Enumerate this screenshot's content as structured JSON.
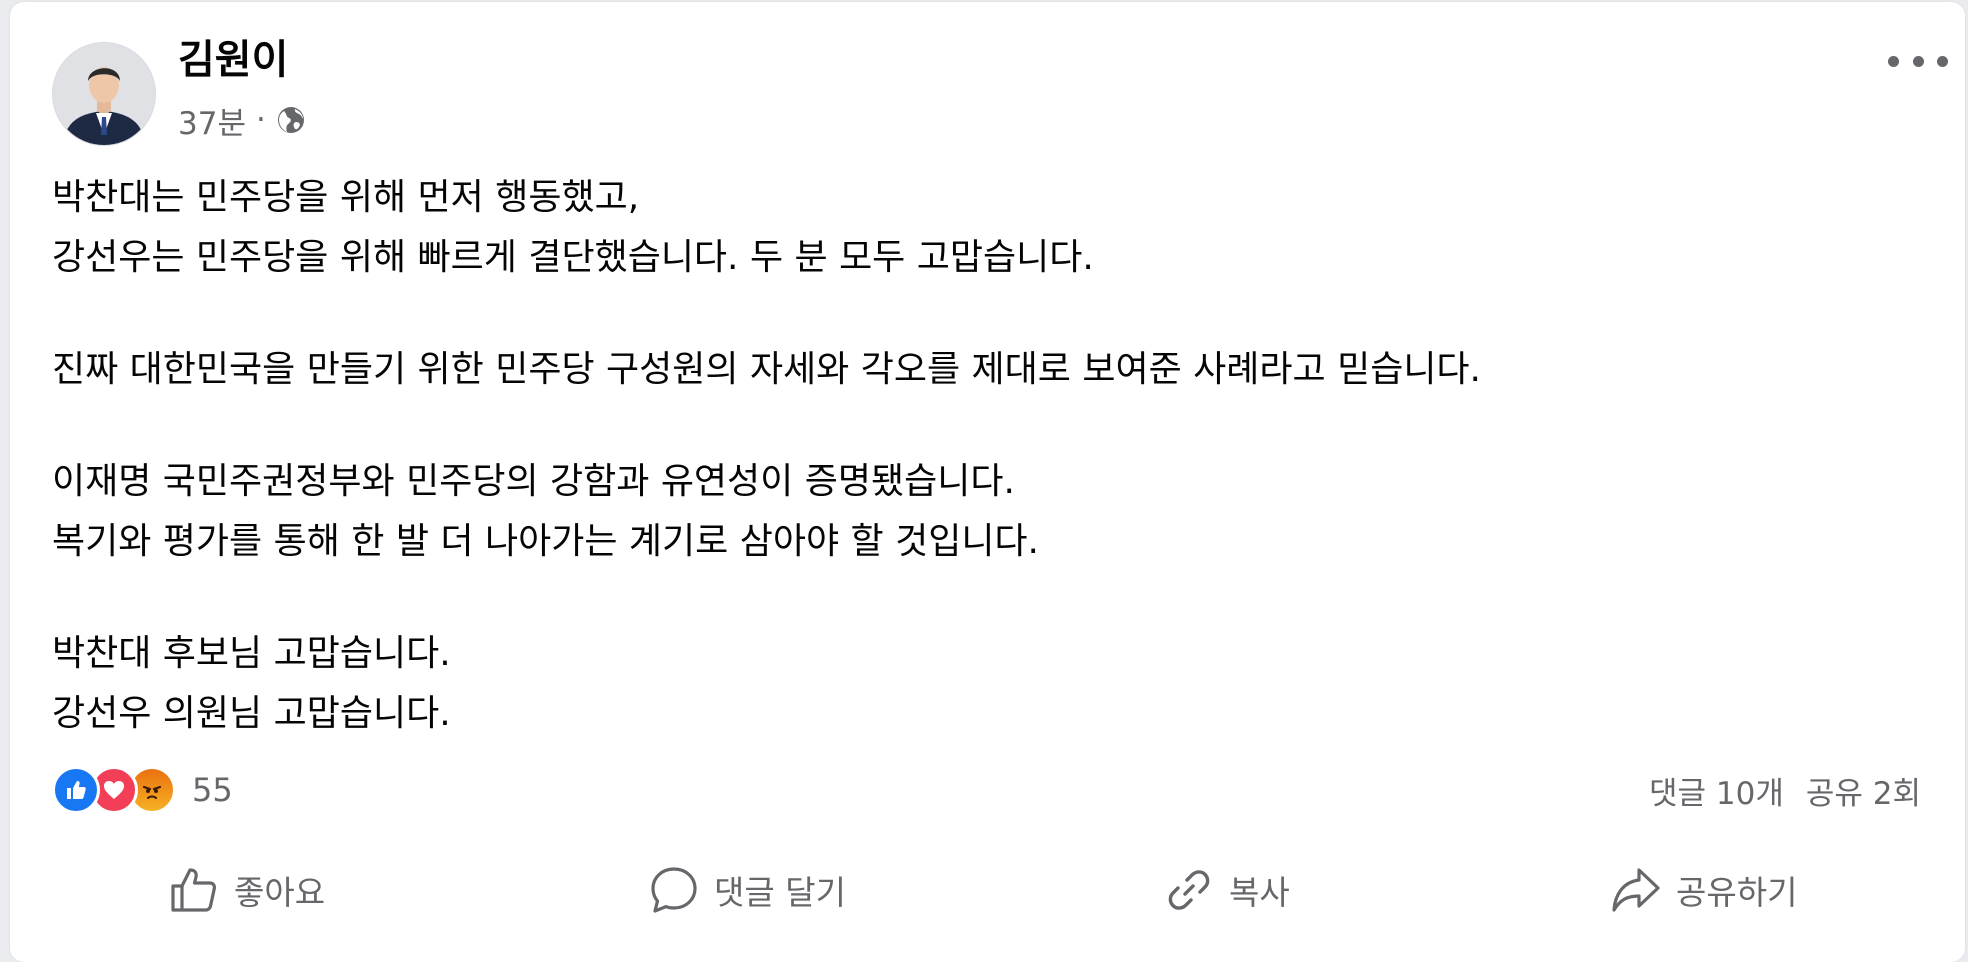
{
  "post": {
    "author": "김원이",
    "time": "37분",
    "separator": "·",
    "privacy_icon": "globe-icon",
    "more_icon": "more-horizontal-icon",
    "paragraphs": [
      [
        "박찬대는 민주당을 위해 먼저 행동했고,",
        "강선우는 민주당을 위해 빠르게 결단했습니다. 두 분 모두 고맙습니다."
      ],
      [
        "진짜 대한민국을 만들기 위한 민주당 구성원의 자세와 각오를 제대로 보여준 사례라고 믿습니다."
      ],
      [
        "이재명 국민주권정부와 민주당의 강함과 유연성이 증명됐습니다.",
        "복기와 평가를 통해 한 발 더 나아가는 계기로 삼아야 할 것입니다."
      ],
      [
        "박찬대 후보님 고맙습니다.",
        "강선우 의원님 고맙습니다."
      ]
    ]
  },
  "reactions": {
    "icons": [
      "like-reaction-icon",
      "love-reaction-icon",
      "angry-reaction-icon"
    ],
    "count": "55",
    "comments": "댓글 10개",
    "shares": "공유 2회"
  },
  "actions": {
    "like": "좋아요",
    "comment": "댓글 달기",
    "copy": "복사",
    "share": "공유하기"
  },
  "colors": {
    "like_blue": "#1877f2",
    "love_red": "#f33e58",
    "angry_orange": "#f0703c",
    "secondary_text": "#65676b"
  }
}
